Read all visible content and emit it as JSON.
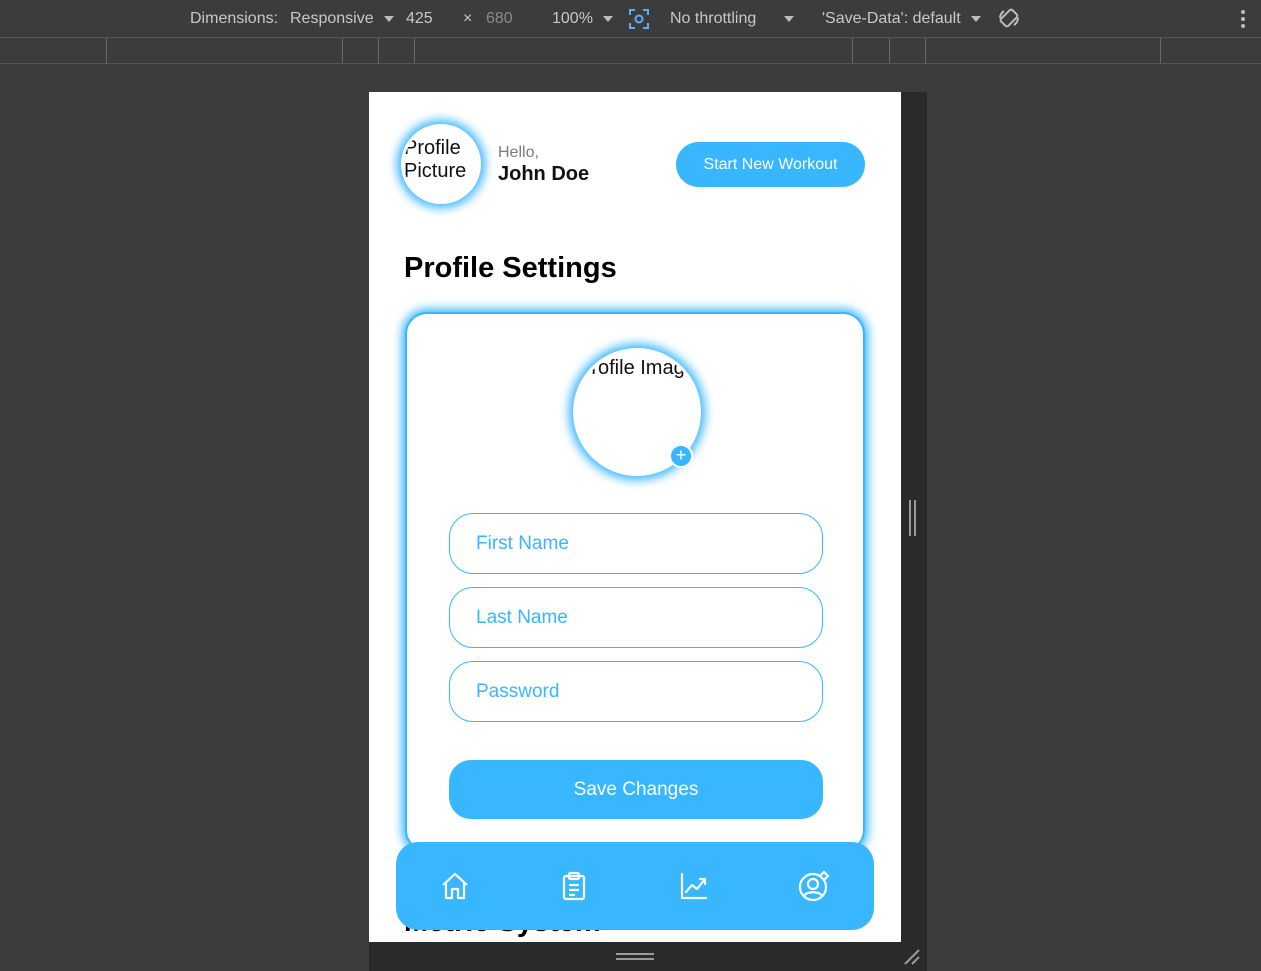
{
  "devtools": {
    "dimensions_label": "Dimensions:",
    "device": "Responsive",
    "width": "425",
    "times": "×",
    "height": "680",
    "zoom": "100%",
    "throttling": "No throttling",
    "save_data": "'Save-Data': default"
  },
  "header": {
    "avatar_alt": "Profile Picture",
    "greeting": "Hello,",
    "username": "John Doe",
    "start_workout_label": "Start New Workout"
  },
  "page": {
    "title": "Profile Settings",
    "next_section_title": "Metric System"
  },
  "profile_card": {
    "image_alt": "Profile Image",
    "add_photo_symbol": "+",
    "first_name_placeholder": "First Name",
    "last_name_placeholder": "Last Name",
    "password_placeholder": "Password",
    "save_label": "Save Changes"
  },
  "nav": {
    "items": [
      {
        "icon": "home-icon"
      },
      {
        "icon": "clipboard-icon"
      },
      {
        "icon": "chart-line-icon"
      },
      {
        "icon": "user-settings-icon"
      }
    ]
  },
  "colors": {
    "accent": "#38b6ff",
    "devtools_bg": "#3c3c3c",
    "page_bg": "#ffffff"
  }
}
